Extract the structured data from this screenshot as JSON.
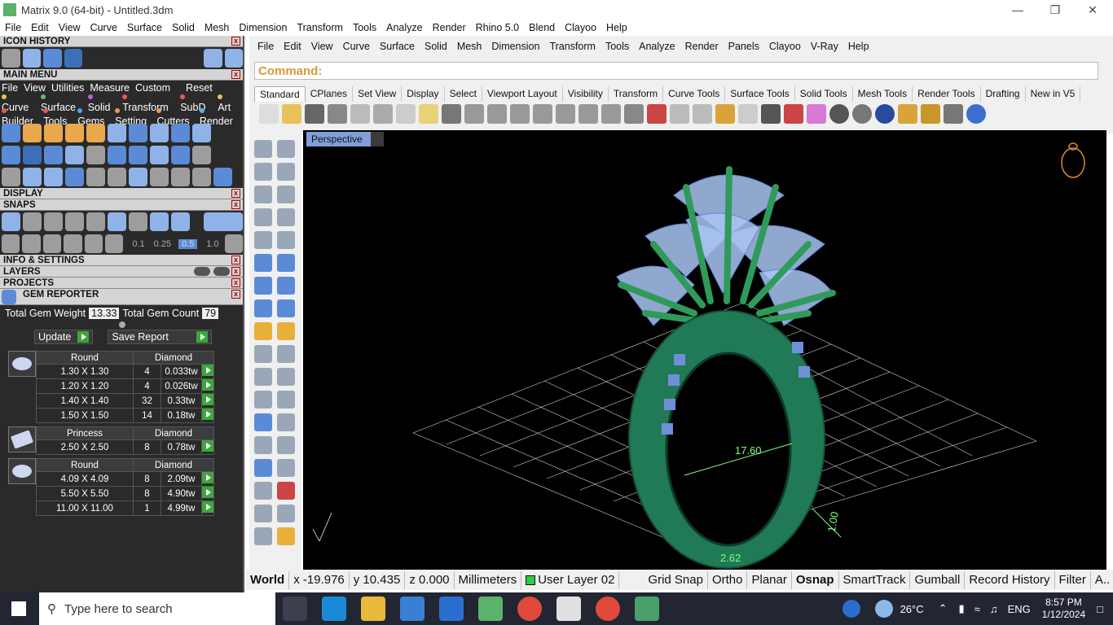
{
  "window": {
    "title": "Matrix 9.0 (64-bit) - Untitled.3dm"
  },
  "matrix_menu": [
    "File",
    "Edit",
    "View",
    "Curve",
    "Surface",
    "Solid",
    "Mesh",
    "Dimension",
    "Transform",
    "Tools",
    "Analyze",
    "Render",
    "Rhino 5.0",
    "Blend",
    "Clayoo",
    "Help"
  ],
  "panels": {
    "icon_history": "ICON HISTORY",
    "main_menu": "MAIN MENU",
    "main_menu_row1": [
      "File",
      "View",
      "Utilities",
      "Measure",
      "Custom",
      "Reset"
    ],
    "main_menu_row2": [
      "Curve",
      "Surface",
      "Solid",
      "Transform",
      "SubD",
      "Art"
    ],
    "main_menu_row3": [
      "Builder",
      "Tools",
      "Gems",
      "Setting",
      "Cutters",
      "Render"
    ],
    "display": "DISPLAY",
    "snaps": "SNAPS",
    "snap_values": [
      "0.1",
      "0.25",
      "0.5",
      "1.0"
    ],
    "info_settings": "INFO & SETTINGS",
    "layers": "LAYERS",
    "projects": "PROJECTS",
    "gem_reporter": "GEM REPORTER"
  },
  "gem_reporter": {
    "total_weight_label": "Total Gem Weight",
    "total_weight": "13.33",
    "total_count_label": "Total Gem Count",
    "total_count": "79",
    "update_label": "Update",
    "save_report_label": "Save Report",
    "groups": [
      {
        "shape": "Round",
        "material": "Diamond",
        "rows": [
          {
            "size": "1.30 X 1.30",
            "count": "4",
            "weight": "0.033tw"
          },
          {
            "size": "1.20 X 1.20",
            "count": "4",
            "weight": "0.026tw"
          },
          {
            "size": "1.40 X 1.40",
            "count": "32",
            "weight": "0.33tw"
          },
          {
            "size": "1.50 X 1.50",
            "count": "14",
            "weight": "0.18tw"
          }
        ]
      },
      {
        "shape": "Princess",
        "material": "Diamond",
        "rows": [
          {
            "size": "2.50 X 2.50",
            "count": "8",
            "weight": "0.78tw"
          }
        ]
      },
      {
        "shape": "Round",
        "material": "Diamond",
        "rows": [
          {
            "size": "4.09 X 4.09",
            "count": "8",
            "weight": "2.09tw"
          },
          {
            "size": "5.50 X 5.50",
            "count": "8",
            "weight": "4.90tw"
          },
          {
            "size": "11.00 X 11.00",
            "count": "1",
            "weight": "4.99tw"
          }
        ]
      }
    ]
  },
  "rhino_menu": [
    "File",
    "Edit",
    "View",
    "Curve",
    "Surface",
    "Solid",
    "Mesh",
    "Dimension",
    "Transform",
    "Tools",
    "Analyze",
    "Render",
    "Panels",
    "Clayoo",
    "V-Ray",
    "Help"
  ],
  "command_label": "Command:",
  "toolbar_tabs": [
    "Standard",
    "CPlanes",
    "Set View",
    "Display",
    "Select",
    "Viewport Layout",
    "Visibility",
    "Transform",
    "Curve Tools",
    "Surface Tools",
    "Solid Tools",
    "Mesh Tools",
    "Render Tools",
    "Drafting",
    "New in V5"
  ],
  "viewport": {
    "name": "Perspective",
    "dim1": "17.60",
    "dim2": "1.00",
    "dim3": "2.62"
  },
  "status": {
    "cplane": "World",
    "x": "x -19.976",
    "y": "y 10.435",
    "z": "z 0.000",
    "units": "Millimeters",
    "layer": "User Layer 02",
    "toggles": [
      "Grid Snap",
      "Ortho",
      "Planar",
      "Osnap",
      "SmartTrack",
      "Gumball",
      "Record History",
      "Filter",
      "A.."
    ]
  },
  "taskbar": {
    "search_placeholder": "Type here to search",
    "weather": "26°C",
    "lang": "ENG",
    "time": "8:57 PM",
    "date": "1/12/2024"
  }
}
